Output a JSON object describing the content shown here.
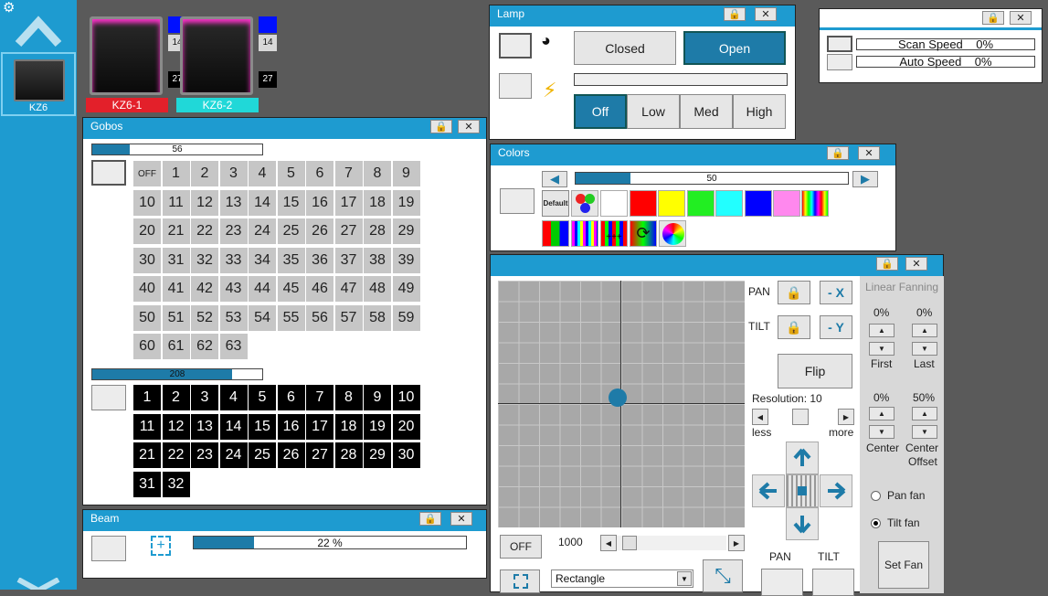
{
  "sidebar": {
    "fixture_label": "KZ6"
  },
  "fixtures": [
    {
      "name": "KZ6-1",
      "color": "#e3202a",
      "num_top": "14",
      "num_bottom": "27"
    },
    {
      "name": "KZ6-2",
      "color": "#20d8d8",
      "num_top": "14",
      "num_bottom": "27"
    }
  ],
  "gobos": {
    "title": "Gobos",
    "slider1_value": "56",
    "slider1_fraction": 0.22,
    "off_label": "OFF",
    "grid1": [
      "1",
      "2",
      "3",
      "4",
      "5",
      "6",
      "7",
      "8",
      "9",
      "10",
      "11",
      "12",
      "13",
      "14",
      "15",
      "16",
      "17",
      "18",
      "19",
      "20",
      "21",
      "22",
      "23",
      "24",
      "25",
      "26",
      "27",
      "28",
      "29",
      "30",
      "31",
      "32",
      "33",
      "34",
      "35",
      "36",
      "37",
      "38",
      "39",
      "40",
      "41",
      "42",
      "43",
      "44",
      "45",
      "46",
      "47",
      "48",
      "49",
      "50",
      "51",
      "52",
      "53",
      "54",
      "55",
      "56",
      "57",
      "58",
      "59",
      "60",
      "61",
      "62",
      "63"
    ],
    "slider2_value": "208",
    "slider2_fraction": 0.82,
    "grid2": [
      "1",
      "2",
      "3",
      "4",
      "5",
      "6",
      "7",
      "8",
      "9",
      "10",
      "11",
      "12",
      "13",
      "14",
      "15",
      "16",
      "17",
      "18",
      "19",
      "20",
      "21",
      "22",
      "23",
      "24",
      "25",
      "26",
      "27",
      "28",
      "29",
      "30",
      "31",
      "32"
    ]
  },
  "beam": {
    "title": "Beam",
    "value": "22 %",
    "fraction": 0.22
  },
  "lamp": {
    "title": "Lamp",
    "closed": "Closed",
    "open": "Open",
    "off": "Off",
    "low": "Low",
    "med": "Med",
    "high": "High"
  },
  "speeds": {
    "scan_label": "Scan Speed",
    "scan_value": "0%",
    "auto_label": "Auto Speed",
    "auto_value": "0%"
  },
  "colors": {
    "title": "Colors",
    "slider_value": "50",
    "slider_fraction": 0.2,
    "default_label": "Default",
    "swatches": [
      "#ffffff",
      "#ff0000",
      "#ffff00",
      "#22ee22",
      "#22ffff",
      "#0000ff",
      "#ff88ee"
    ]
  },
  "pantilt": {
    "pan": "PAN",
    "tilt": "TILT",
    "minus_x": "- X",
    "minus_y": "- Y",
    "flip": "Flip",
    "resolution": "Resolution: 10",
    "less": "less",
    "more": "more",
    "off": "OFF",
    "speed_value": "1000",
    "shape": "Rectangle",
    "pan_bottom": "PAN",
    "tilt_bottom": "TILT",
    "fan_title": "Linear Fanning",
    "first_value": "0%",
    "first_label": "First",
    "last_value": "0%",
    "last_label": "Last",
    "center_value": "0%",
    "center_label": "Center",
    "offset_value": "50%",
    "offset_label1": "Center",
    "offset_label2": "Offset",
    "pan_fan": "Pan fan",
    "tilt_fan": "Tilt fan",
    "set_fan": "Set Fan"
  }
}
